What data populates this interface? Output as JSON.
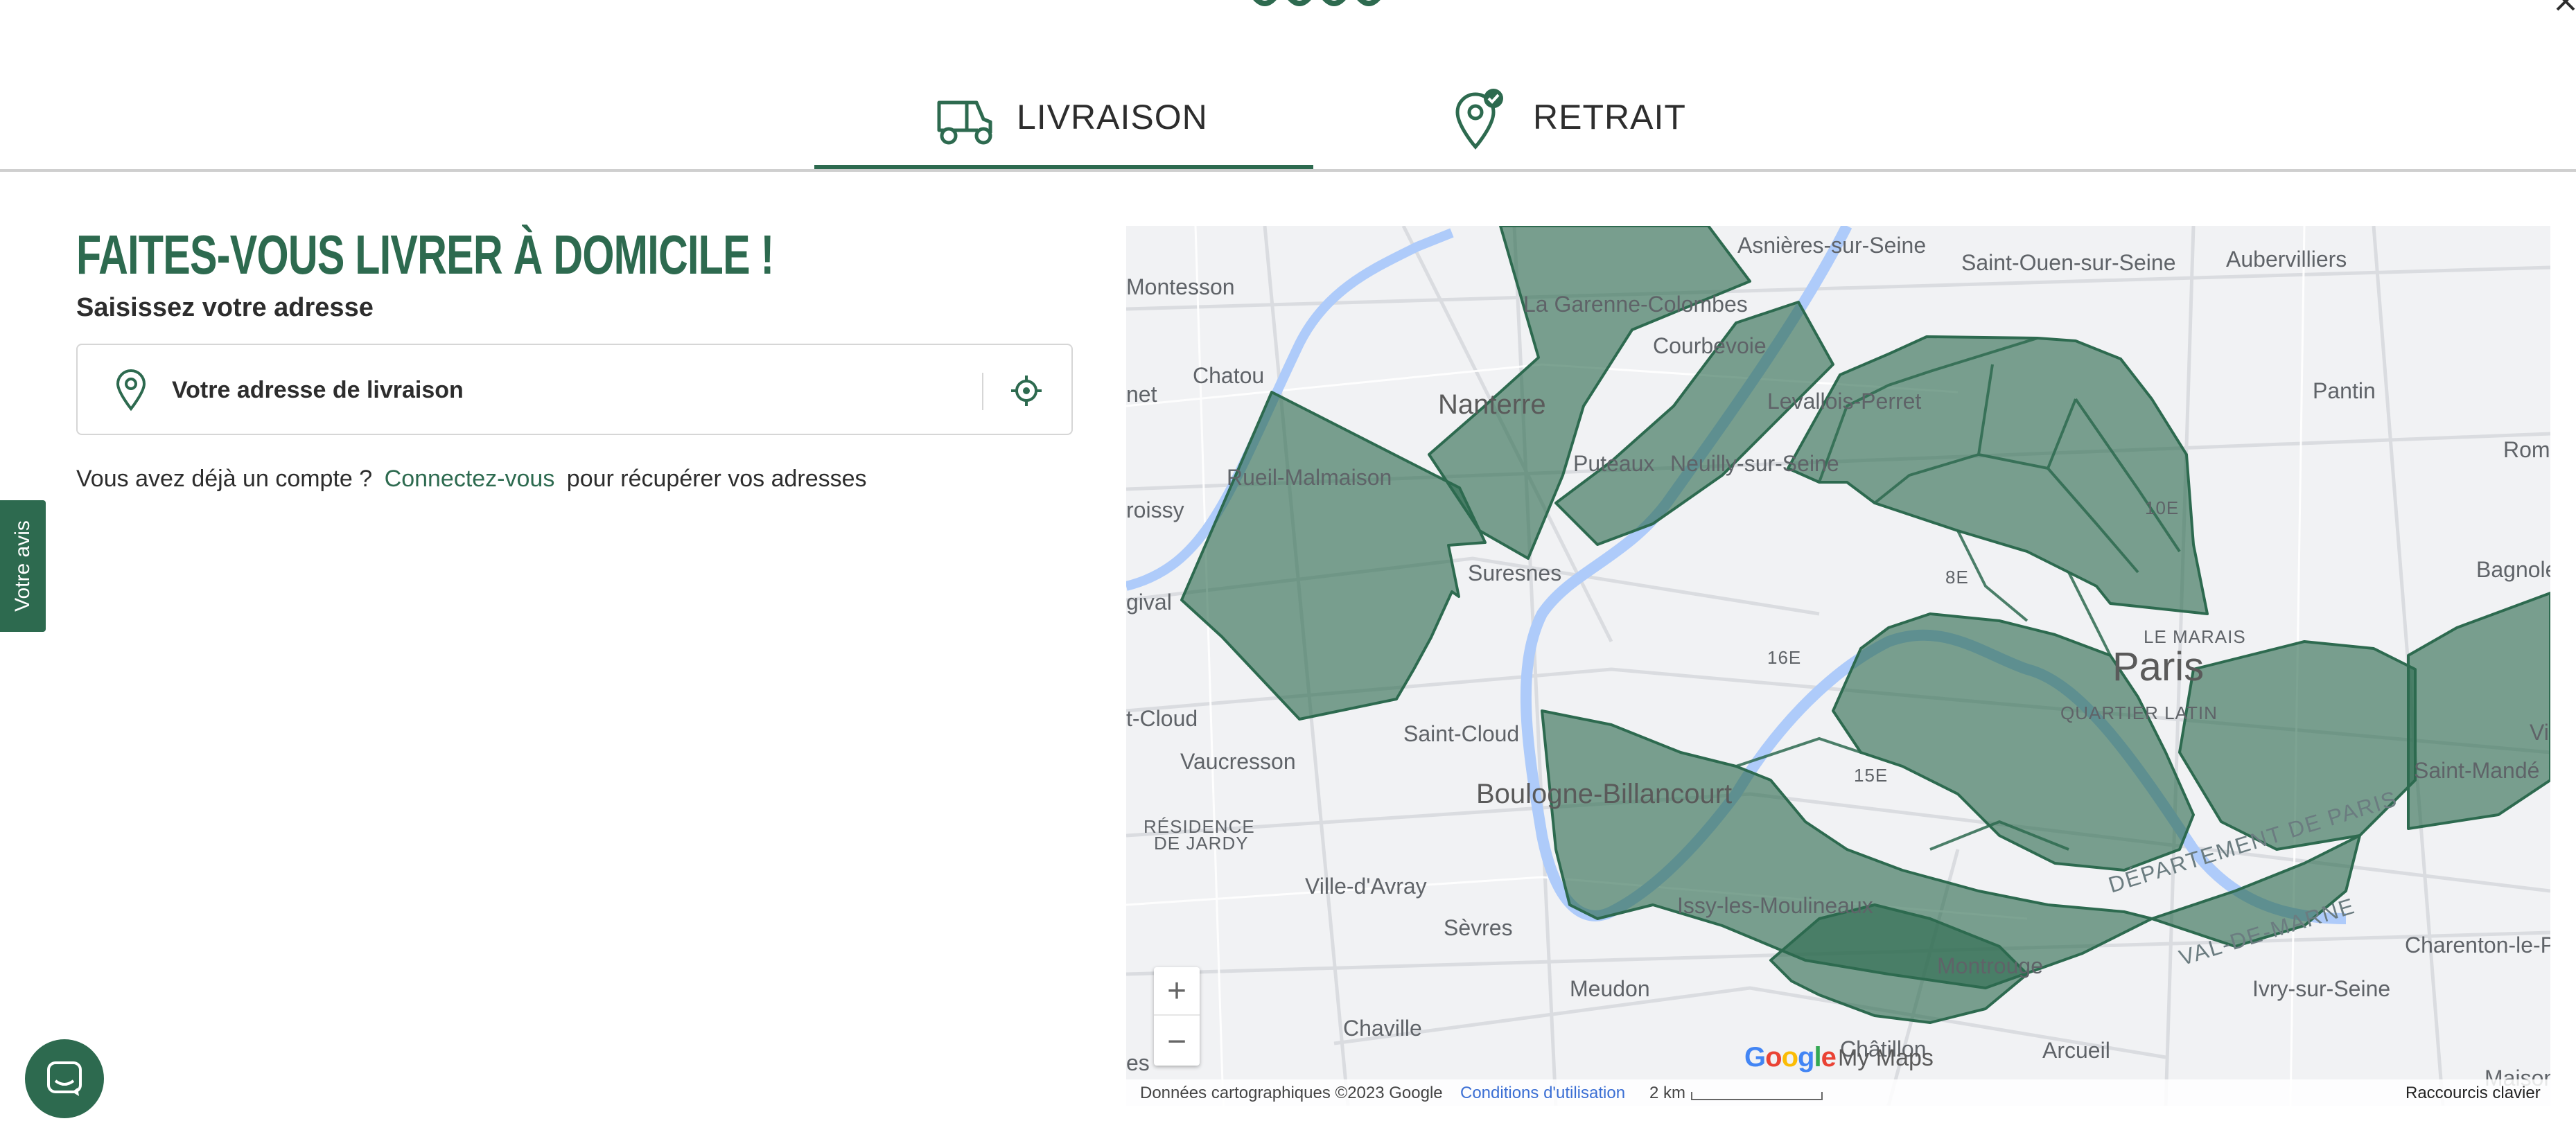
{
  "tabs": [
    {
      "label": "LIVRAISON",
      "icon": "delivery-scooter-icon",
      "active": true
    },
    {
      "label": "RETRAIT",
      "icon": "pickup-pin-check-icon",
      "active": false
    }
  ],
  "delivery": {
    "headline": "FAITES-VOUS LIVRER À DOMICILE !",
    "subhead": "Saisissez votre adresse",
    "address_placeholder": "Votre adresse de livraison",
    "account_prefix": "Vous avez déjà un compte ?",
    "account_link": "Connectez-vous",
    "account_suffix": "pour récupérer vos adresses"
  },
  "feedback_tab": "Votre avis",
  "map": {
    "labels": {
      "montesson": "Montesson",
      "asnieres": "Asnières-sur-Seine",
      "saint_ouen": "Saint-Ouen-sur-Seine",
      "aubervilliers": "Aubervilliers",
      "garenne": "La Garenne-Colombes",
      "courbevoie": "Courbevoie",
      "chatou": "Chatou",
      "nanterre": "Nanterre",
      "levallois": "Levallois-Perret",
      "pantin": "Pantin",
      "net": "net",
      "romainville": "Rom",
      "puteaux": "Puteaux",
      "neuilly": "Neuilly-sur-Seine",
      "rueil": "Rueil-Malmaison",
      "croissy": "roissy",
      "arr10": "10E",
      "suresnes": "Suresnes",
      "arr8": "8E",
      "bagnolet": "Bagnolet",
      "bougival": "gival",
      "le_marais": "LE MARAIS",
      "paris": "Paris",
      "arr16": "16E",
      "quartier_latin": "QUARTIER LATIN",
      "la_celle": "t-Cloud",
      "vincennes": "Vi",
      "saint_cloud": "Saint-Cloud",
      "saint_mande": "Saint-Mandé",
      "vaucresson": "Vaucresson",
      "arr15": "15E",
      "boulogne": "Boulogne-Billancourt",
      "residence": "RÉSIDENCE",
      "de_jardy": "DE JARDY",
      "ville_avray": "Ville-d'Avray",
      "departement": "DÉPARTEMENT DE PARIS",
      "issy": "Issy-les-Moulineaux",
      "sevres": "Sèvres",
      "charenton": "Charenton-le-Pon",
      "val_de_marne": "VAL-DE-MARNE",
      "montrouge": "Montrouge",
      "meudon": "Meudon",
      "ivry": "Ivry-sur-Seine",
      "chaville": "Chaville",
      "chatillon": "Châtillon",
      "arcueil": "Arcueil",
      "maisons": "Maisons",
      "es": "es"
    },
    "zoom_in": "+",
    "zoom_out": "−",
    "google_logo": "Google",
    "my_maps": "My Maps",
    "attribution": "Données cartographiques ©2023 Google",
    "terms": "Conditions d'utilisation",
    "scale": "2 km",
    "shortcuts": "Raccourcis clavier",
    "zone_color": "#2d6a4f"
  },
  "brand_color": "#2d6a4f"
}
